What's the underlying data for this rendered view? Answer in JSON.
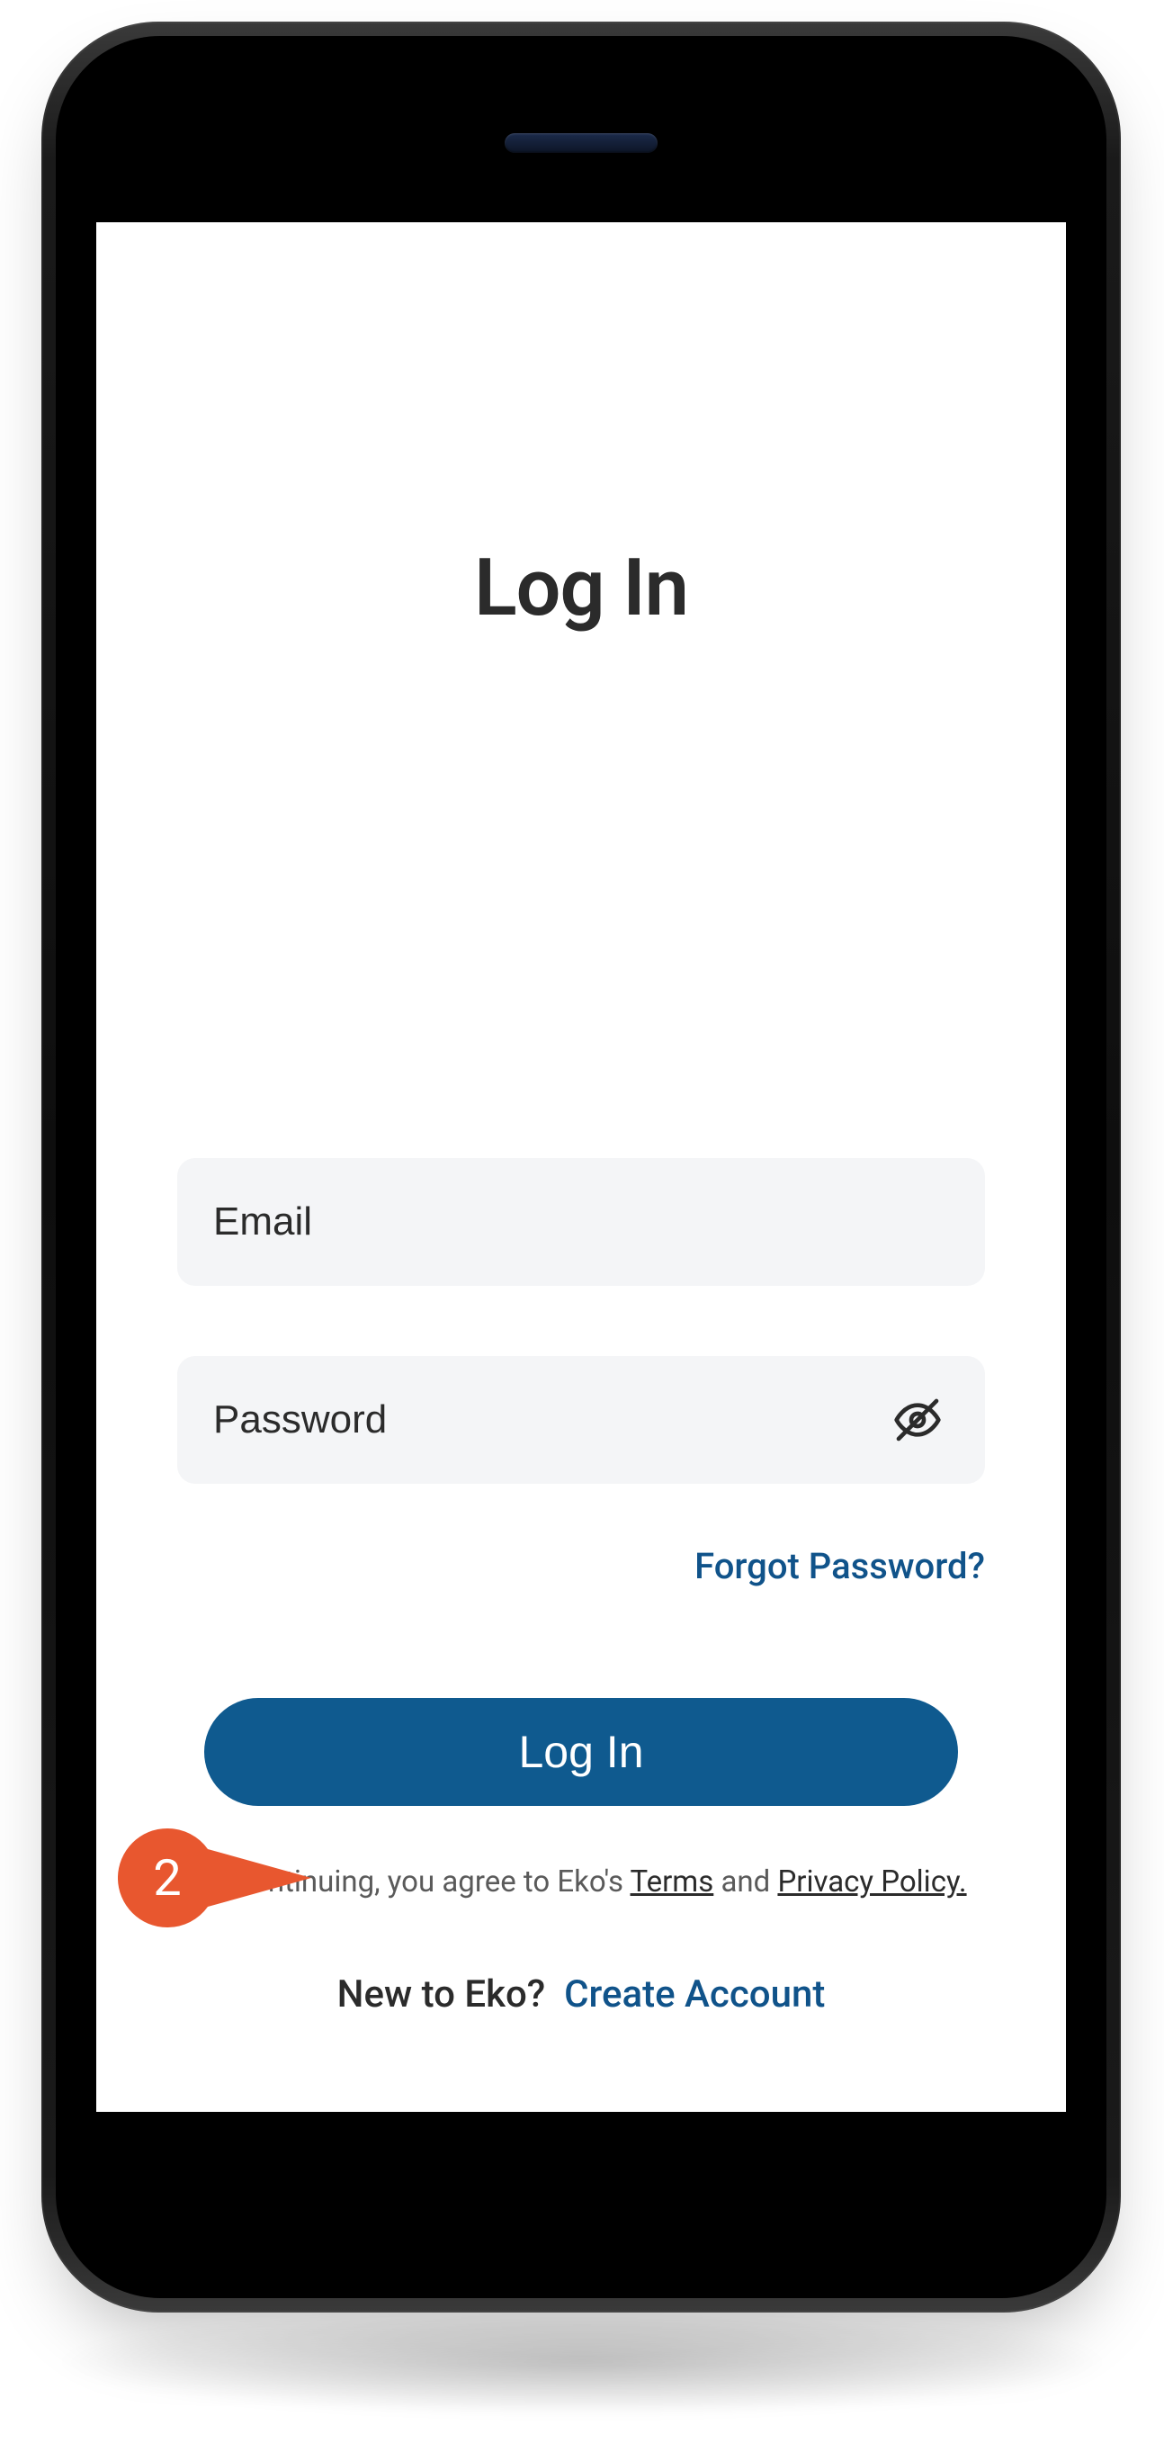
{
  "title": "Log In",
  "fields": {
    "email_placeholder": "Email",
    "password_placeholder": "Password"
  },
  "links": {
    "forgot": "Forgot Password?"
  },
  "buttons": {
    "login": "Log In"
  },
  "consent": {
    "prefix": "By continuing, you agree to Eko's ",
    "terms": "Terms",
    "mid": " and ",
    "privacy": "Privacy Policy."
  },
  "footer": {
    "prompt": "New to Eko?",
    "create": "Create Account"
  },
  "callout": {
    "number": "2"
  }
}
